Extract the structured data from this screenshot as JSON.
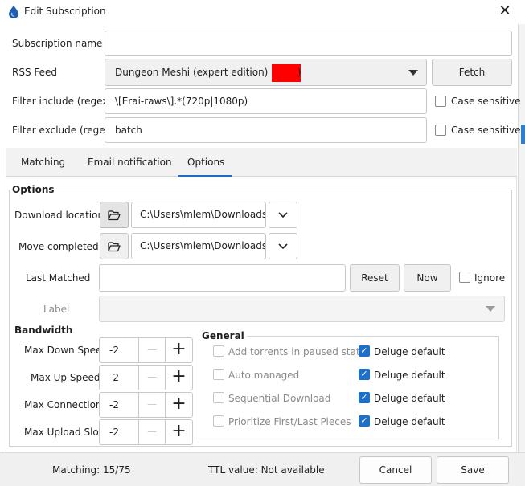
{
  "window": {
    "title": "Edit Subscription",
    "close_glyph": "✕"
  },
  "form": {
    "subscription_name_label": "Subscription name",
    "subscription_name_value": "",
    "rss_feed_label": "RSS Feed",
    "rss_feed_value": "Dungeon Meshi (expert edition) (",
    "rss_feed_value_tail": ")",
    "fetch_label": "Fetch",
    "filter_include_label": "Filter include (regex)",
    "filter_include_value": "\\[Erai-raws\\].*(720p|1080p)",
    "filter_exclude_label": "Filter exclude (regex)",
    "filter_exclude_value": "batch",
    "case_sensitive_label": "Case sensitive",
    "redaction_color": "#ff0000"
  },
  "tabs": [
    {
      "label": "Matching",
      "active": false
    },
    {
      "label": "Email notification",
      "active": false
    },
    {
      "label": "Options",
      "active": true
    }
  ],
  "options": {
    "group_title": "Options",
    "download_location_label": "Download location",
    "download_location_value": "C:\\Users\\mlem\\Downloads",
    "move_completed_label": "Move completed",
    "move_completed_value": "C:\\Users\\mlem\\Downloads",
    "last_matched_label": "Last Matched",
    "last_matched_value": "",
    "reset_label": "Reset",
    "now_label": "Now",
    "ignore_label": "Ignore",
    "label_label": "Label",
    "label_value": ""
  },
  "bandwidth": {
    "title": "Bandwidth",
    "rows": [
      {
        "label": "Max Down Speed",
        "value": "-2"
      },
      {
        "label": "Max Up Speed",
        "value": "-2"
      },
      {
        "label": "Max Connections",
        "value": "-2"
      },
      {
        "label": "Max Upload Slots",
        "value": "-2"
      }
    ],
    "minus_glyph": "—",
    "plus_glyph": "+"
  },
  "general": {
    "title": "General",
    "items": [
      {
        "label": "Add torrents in paused state",
        "checked": false,
        "default_label": "Deluge default",
        "default_checked": true
      },
      {
        "label": "Auto managed",
        "checked": false,
        "default_label": "Deluge default",
        "default_checked": true
      },
      {
        "label": "Sequential Download",
        "checked": false,
        "default_label": "Deluge default",
        "default_checked": true
      },
      {
        "label": "Prioritize First/Last Pieces",
        "checked": false,
        "default_label": "Deluge default",
        "default_checked": true
      }
    ]
  },
  "status": {
    "matching": "Matching: 15/75",
    "ttl": "TTL value: Not available",
    "cancel_label": "Cancel",
    "save_label": "Save"
  },
  "colors": {
    "accent": "#1d6fc9",
    "tab_underline": "#1e6cc7"
  }
}
